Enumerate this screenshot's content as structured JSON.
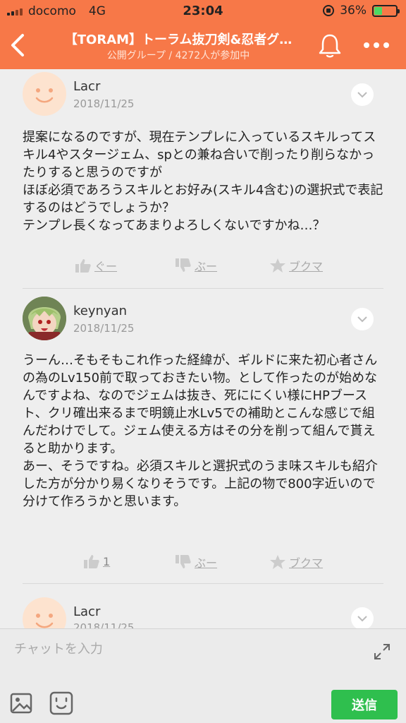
{
  "status_bar": {
    "carrier": "docomo",
    "network": "4G",
    "time": "23:04",
    "battery": "36%",
    "battery_fraction": 0.36
  },
  "header": {
    "title": "【TORAM】トーラム抜刀剣&忍者グ…",
    "subtitle": "公開グループ / 4272人が参加中"
  },
  "posts": [
    {
      "author": "Lacr",
      "date": "2018/11/25",
      "body": "提案になるのですが、現在テンプレに入っているスキルってスキル4やスタージェム、spとの兼ね合いで削ったり削らなかったりすると思うのですが\nほぼ必須であろうスキルとお好み(スキル4含む)の選択式で表記するのはどうでしょうか？\nテンプレ長くなってあまりよろしくないですかね…？",
      "like": "ぐー",
      "dislike": "ぶー",
      "bookmark": "ブクマ"
    },
    {
      "author": "keynyan",
      "date": "2018/11/25",
      "body": "うーん…そもそもこれ作った経緯が、ギルドに来た初心者さんの為のLv150前で取っておきたい物。として作ったのが始めなんですよね、なのでジェムは抜き、死ににくい様にHPブースト、クリ確出来るまで明鏡止水Lv5での補助とこんな感じで組んだわけでして。ジェム使える方はその分を削って組んで貰えると助かります。\nあー、そうですね。必須スキルと選択式のうま味スキルも紹介した方が分かり易くなりそうです。上記の物で800字近いので分けて作ろうかと思います。",
      "like": "1",
      "dislike": "ぶー",
      "bookmark": "ブクマ"
    },
    {
      "author": "Lacr",
      "date": "2018/11/25"
    }
  ],
  "input": {
    "placeholder": "チャットを入力",
    "send_label": "送信"
  },
  "colors": {
    "accent": "#f77848",
    "send": "#2fbf4e"
  }
}
